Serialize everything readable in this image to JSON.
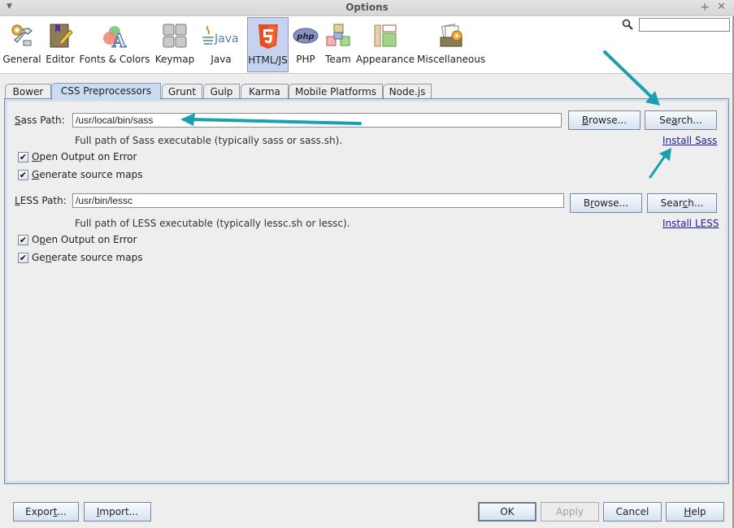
{
  "window": {
    "title": "Options",
    "maximize_glyph": "+",
    "close_glyph": "✕",
    "menu_glyph": "▼"
  },
  "toolbar": {
    "categories": [
      {
        "label": "General",
        "icon": "wrench-gear-icon"
      },
      {
        "label": "Editor",
        "icon": "book-pencil-icon"
      },
      {
        "label": "Fonts & Colors",
        "icon": "font-colors-icon"
      },
      {
        "label": "Keymap",
        "icon": "keyboard-keys-icon"
      },
      {
        "label": "Java",
        "icon": "java-logo-icon"
      },
      {
        "label": "HTML/JS",
        "icon": "html5-icon",
        "selected": true
      },
      {
        "label": "PHP",
        "icon": "php-logo-icon"
      },
      {
        "label": "Team",
        "icon": "cubes-icon"
      },
      {
        "label": "Appearance",
        "icon": "layout-panels-icon"
      },
      {
        "label": "Miscellaneous",
        "icon": "folder-gear-icon"
      }
    ],
    "search_placeholder": "",
    "search_value": ""
  },
  "tabs": [
    {
      "label": "Bower"
    },
    {
      "label": "CSS Preprocessors",
      "selected": true
    },
    {
      "label": "Grunt"
    },
    {
      "label": "Gulp"
    },
    {
      "label": "Karma"
    },
    {
      "label": "Mobile Platforms"
    },
    {
      "label": "Node.js"
    }
  ],
  "sass": {
    "label_mnemonic": "S",
    "label_rest": "ass Path:",
    "path_value": "/usr/local/bin/sass",
    "browse_pre": "",
    "browse_mn": "B",
    "browse_post": "rowse...",
    "search_pre": "Se",
    "search_mn": "a",
    "search_post": "rch...",
    "hint": "Full path of Sass executable (typically sass or sass.sh).",
    "install_link": "Install Sass",
    "open_output": {
      "mn": "O",
      "rest": "pen Output on Error",
      "checked": true
    },
    "source_maps": {
      "mn": "G",
      "rest": "enerate source maps",
      "checked": true
    }
  },
  "less": {
    "label_mnemonic": "L",
    "label_rest": "ESS Path:",
    "path_value": "/usr/bin/lessc",
    "browse_pre": "B",
    "browse_mn": "r",
    "browse_post": "owse...",
    "search_pre": "Sear",
    "search_mn": "c",
    "search_post": "h...",
    "hint": "Full path of LESS executable (typically lessc.sh or lessc).",
    "install_link": "Install LESS",
    "open_output": {
      "pre": "O",
      "mn": "p",
      "rest": "en Output on Error",
      "checked": true
    },
    "source_maps": {
      "pre": "Ge",
      "mn": "n",
      "rest": "erate source maps",
      "checked": true
    }
  },
  "footer": {
    "export": {
      "pre": "Expor",
      "mn": "t",
      "post": "..."
    },
    "import": {
      "pre": "",
      "mn": "I",
      "post": "mport..."
    },
    "ok": "OK",
    "apply": "Apply",
    "cancel": "Cancel",
    "help": {
      "mn": "H",
      "post": "elp"
    }
  },
  "annotation_color": "#1aa0ae",
  "checkmark_glyph": "✔"
}
